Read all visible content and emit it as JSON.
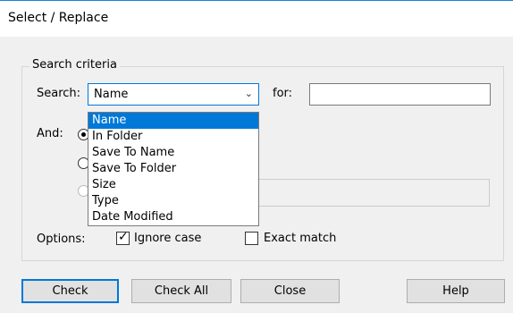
{
  "window": {
    "title": "Select / Replace"
  },
  "group": {
    "label": "Search criteria"
  },
  "search": {
    "label": "Search:",
    "selected": "Name",
    "for_label": "for:",
    "for_value": ""
  },
  "dropdown": {
    "options": [
      "Name",
      "In Folder",
      "Save To Name",
      "Save To Folder",
      "Size",
      "Type",
      "Date Modified"
    ],
    "selected_index": 0
  },
  "and": {
    "label": "And:"
  },
  "options": {
    "label": "Options:",
    "ignore_case": "Ignore case",
    "exact_match": "Exact match",
    "ignore_case_checked": true,
    "exact_match_checked": false
  },
  "buttons": {
    "check": "Check",
    "check_all": "Check All",
    "close": "Close",
    "help": "Help"
  },
  "colors": {
    "accent": "#0078d7"
  }
}
